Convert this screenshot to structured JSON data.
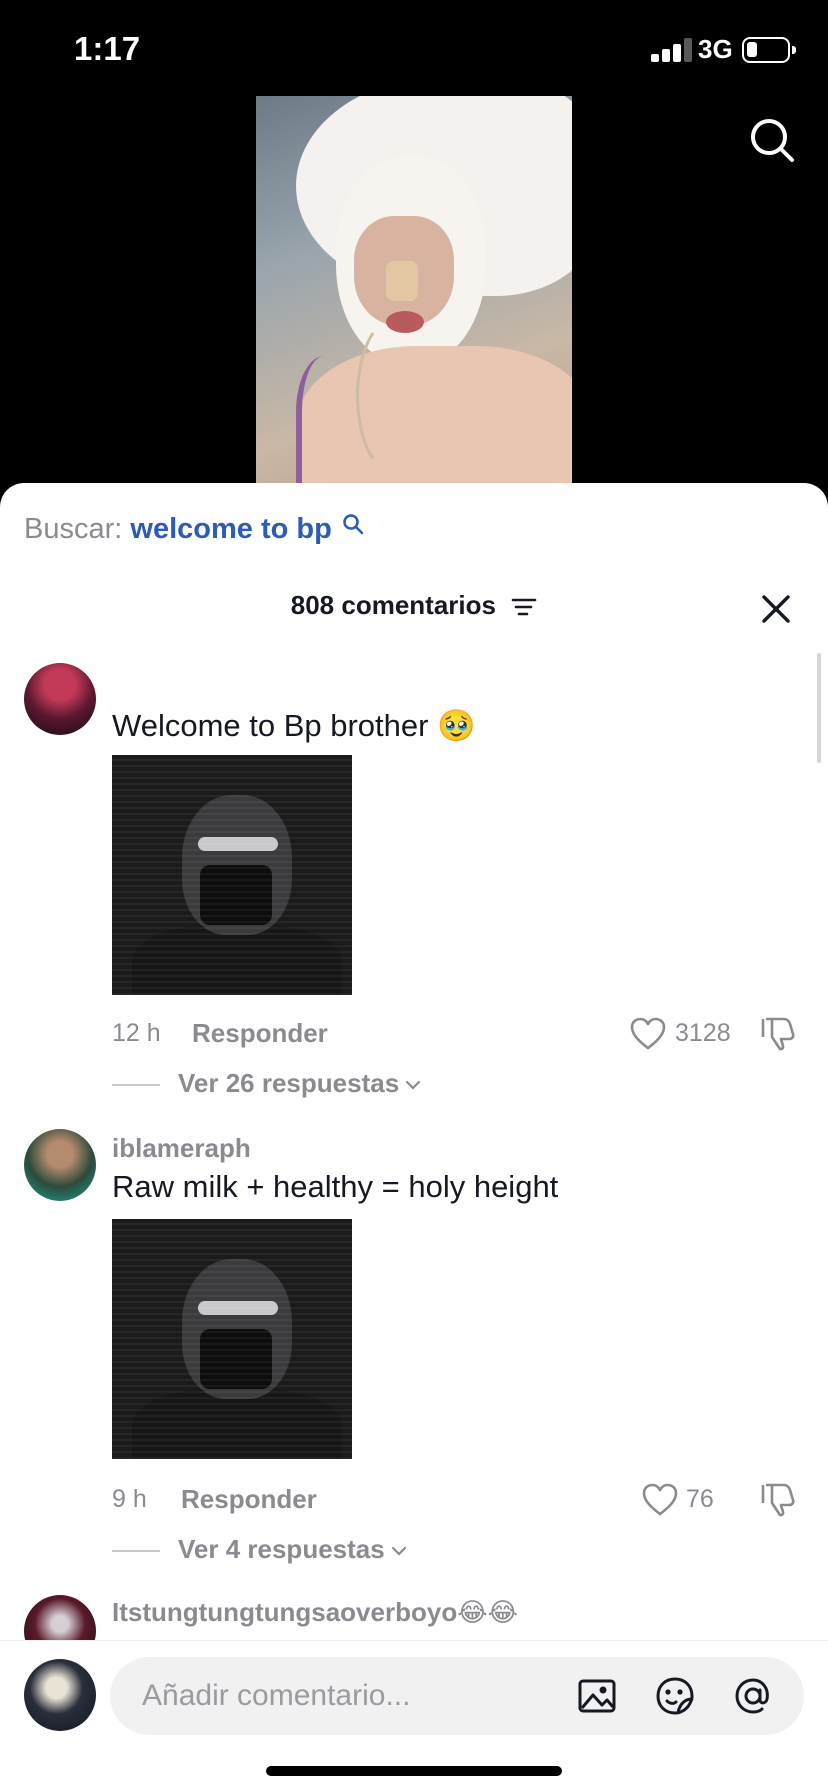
{
  "status_bar": {
    "time": "1:17",
    "network": "3G",
    "battery_level": 0.2
  },
  "search_bar": {
    "prefix": "Buscar:",
    "query": "welcome to bp"
  },
  "header": {
    "count_label": "808 comentarios"
  },
  "comments": [
    {
      "username": "",
      "text": "Welcome to Bp brother 🥹",
      "time": "12 h",
      "reply_label": "Responder",
      "likes": "3128",
      "view_replies": "Ver 26 respuestas"
    },
    {
      "username": "iblameraph",
      "text": "Raw milk + healthy = holy height",
      "time": "9 h",
      "reply_label": "Responder",
      "likes": "76",
      "view_replies": "Ver 4 respuestas"
    },
    {
      "username": "Itstungtungtungsaoverboyo😂😂"
    }
  ],
  "composer": {
    "placeholder": "Añadir comentario..."
  },
  "icons": [
    "search-icon",
    "filter-icon",
    "close-icon",
    "heart-icon",
    "dislike-icon",
    "chevron-down-icon",
    "image-icon",
    "emoji-icon",
    "mention-icon"
  ]
}
